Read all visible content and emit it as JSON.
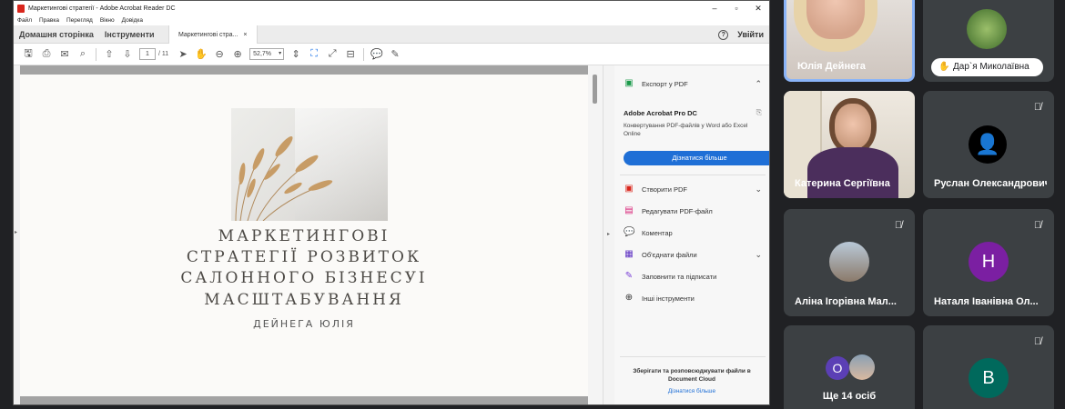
{
  "acrobat": {
    "window_title": "Маркетингові стратегії - Adobe Acrobat Reader DC",
    "window_controls": [
      "–",
      "▫",
      "✕"
    ],
    "menu": [
      "Файл",
      "Правка",
      "Перегляд",
      "Вікно",
      "Довідка"
    ],
    "nav_tabs": [
      "Домашня сторінка",
      "Інструменти"
    ],
    "doc_tab": {
      "label": "Маркетингові стра...",
      "close": "×"
    },
    "help": "?",
    "signin": "Увійти",
    "toolbar": {
      "page_current": "1",
      "page_total": "/ 11",
      "zoom": "52,7%"
    }
  },
  "document": {
    "title_lines": [
      "МАРКЕТИНГОВІ",
      "СТРАТЕГІЇ РОЗВИТОК",
      "САЛОННОГО БІЗНЕСУІ",
      "МАСШТАБУВАННЯ"
    ],
    "author": "ДЕЙНЕГА ЮЛІЯ"
  },
  "right_panel": {
    "export_label": "Експорт у PDF",
    "promo_title": "Adobe Acrobat Pro DC",
    "promo_text": "Конвертування PDF-файлів у Word або Excel Online",
    "promo_button": "Дізнатися більше",
    "tools": [
      {
        "label": "Створити PDF",
        "icon": "create-pdf-icon",
        "glyph": "▣",
        "color": "#d9261c",
        "chevron": true
      },
      {
        "label": "Редагувати PDF-файл",
        "icon": "edit-pdf-icon",
        "glyph": "▤",
        "color": "#d9267a",
        "chevron": false
      },
      {
        "label": "Коментар",
        "icon": "comment-icon",
        "glyph": "💬",
        "color": "#f2b300",
        "chevron": false
      },
      {
        "label": "Об'єднати файли",
        "icon": "combine-files-icon",
        "glyph": "▦",
        "color": "#5c2fc2",
        "chevron": true
      },
      {
        "label": "Заповнити та підписати",
        "icon": "fill-sign-icon",
        "glyph": "✎",
        "color": "#7a3fd6",
        "chevron": false
      },
      {
        "label": "Інші інструменти",
        "icon": "more-tools-icon",
        "glyph": "⊕",
        "color": "#333333",
        "chevron": false
      }
    ],
    "cloud_text": "Зберігати та розповсюджувати файли в Document Cloud",
    "cloud_link": "Дізнатися більше"
  },
  "meet": {
    "participants": [
      {
        "name": "Юлія Дейнега",
        "type": "video1"
      },
      {
        "name": "Дар`я Миколаївна",
        "type": "pill"
      },
      {
        "name": "Катерина Сергіївна",
        "type": "video2"
      },
      {
        "name": "Руслан Олександрович",
        "type": "avatar",
        "initial": "👤",
        "color": "#000000"
      },
      {
        "name": "Аліна Ігорівна Мал...",
        "type": "photo"
      },
      {
        "name": "Наталя Іванівна Ол...",
        "type": "avatar",
        "initial": "Н",
        "color": "#7b1fa2"
      },
      {
        "name": "Ще 14 осіб",
        "type": "more",
        "initial": "О",
        "color": "#5b3fb5"
      },
      {
        "name": "",
        "type": "avatar",
        "initial": "В",
        "color": "#00695c"
      }
    ]
  },
  "colors": {
    "meet_bg": "#202124",
    "tile_bg": "#3c4043",
    "acrobat_blue": "#1f6fd6"
  }
}
